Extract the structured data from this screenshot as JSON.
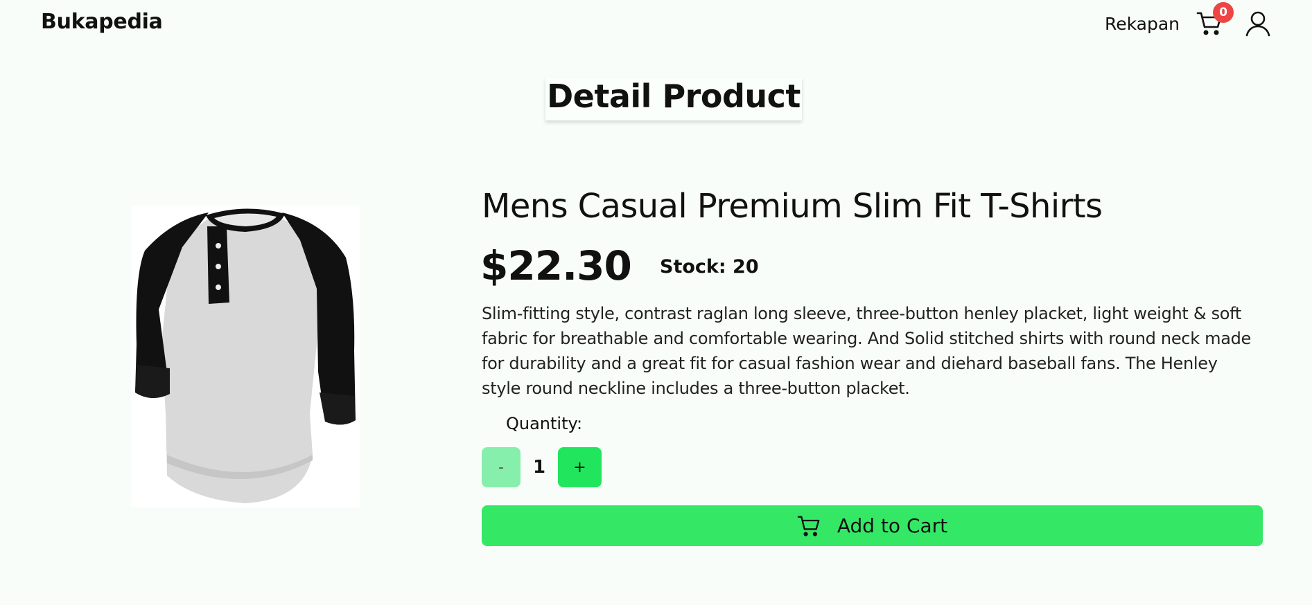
{
  "navbar": {
    "brand": "Bukapedia",
    "link_rekapan": "Rekapan",
    "cart_count": "0",
    "cart_icon": "cart-icon",
    "user_icon": "user-icon"
  },
  "page": {
    "title": "Detail Product"
  },
  "product": {
    "image_alt": "tshirt-image",
    "name": "Mens Casual Premium Slim Fit T-Shirts",
    "price": "$22.30",
    "stock": "Stock: 20",
    "description": "Slim-fitting style, contrast raglan long sleeve, three-button henley placket, light weight & soft fabric for breathable and comfortable wearing. And Solid stitched shirts with round neck made for durability and a great fit for casual fashion wear and diehard baseball fans. The Henley style round neckline includes a three-button placket."
  },
  "quantity": {
    "label": "Quantity:",
    "minus_label": "-",
    "value": "1",
    "plus_label": "+"
  },
  "add_to_cart": {
    "label": "Add to Cart",
    "icon": "cart-icon"
  },
  "colors": {
    "background": "#f8fdf9",
    "accent_green": "#34e866",
    "minus_green": "#86efac",
    "badge_red": "#ef4444"
  }
}
